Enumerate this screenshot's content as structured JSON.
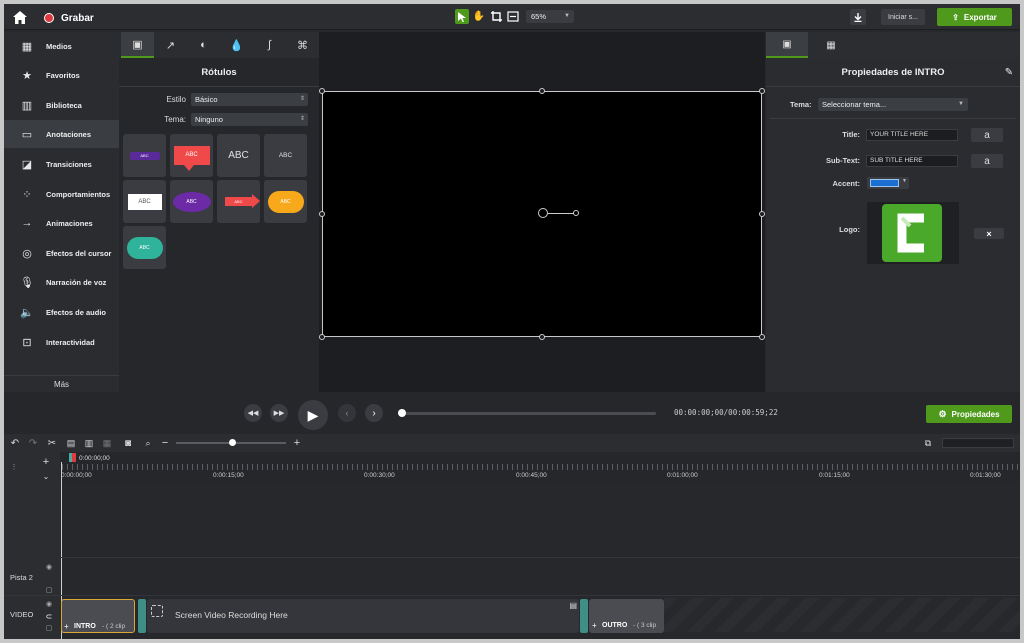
{
  "topbar": {
    "record_label": "Grabar",
    "zoom": "65%",
    "share_label": "Iniciar s...",
    "export_label": "Exportar"
  },
  "leftnav": {
    "items": [
      {
        "label": "Medios",
        "icon": "film-icon"
      },
      {
        "label": "Favoritos",
        "icon": "star-icon"
      },
      {
        "label": "Biblioteca",
        "icon": "library-icon"
      },
      {
        "label": "Anotaciones",
        "icon": "annotation-icon"
      },
      {
        "label": "Transiciones",
        "icon": "transition-icon"
      },
      {
        "label": "Comportamientos",
        "icon": "behavior-icon"
      },
      {
        "label": "Animaciones",
        "icon": "animation-icon"
      },
      {
        "label": "Efectos del cursor",
        "icon": "cursor-icon"
      },
      {
        "label": "Narración de voz",
        "icon": "microphone-icon"
      },
      {
        "label": "Efectos de audio",
        "icon": "speaker-icon"
      },
      {
        "label": "Interactividad",
        "icon": "interactivity-icon"
      }
    ],
    "more_label": "Más"
  },
  "library": {
    "title": "Rótulos",
    "style_label": "Estilo",
    "style_value": "Básico",
    "theme_label": "Tema:",
    "theme_value": "Ninguno",
    "tile_text": "ABC"
  },
  "properties": {
    "title": "Propiedades de INTRO",
    "theme_label": "Tema:",
    "theme_value": "Seleccionar tema...",
    "title_label": "Title:",
    "title_value": "YOUR TITLE HERE",
    "subtext_label": "Sub-Text:",
    "subtext_value": "SUB TITLE HERE",
    "accent_label": "Accent:",
    "accent_color": "#1a6fd0",
    "logo_label": "Logo:",
    "font_button": "a"
  },
  "player": {
    "time": "00:00:00;00/00:00:59;22",
    "properties_label": "Propiedades"
  },
  "timeline": {
    "playhead": "0:00:00;00",
    "ticks": [
      "0:00:00;00",
      "0:00:15;00",
      "0:00:30;00",
      "0:00:45;00",
      "0:01:00;00",
      "0:01:15;00",
      "0:01:30;00"
    ],
    "tracks": [
      "Pista 2",
      "VIDEO"
    ],
    "intro_label": "INTRO",
    "intro_meta": "- ( 2 clip",
    "recording_label": "Screen Video Recording Here",
    "outro_label": "OUTRO",
    "outro_meta": "- ( 3 clip"
  },
  "colors": {
    "accent_green": "#4f9a1c",
    "record_red": "#e0393e",
    "clip_teal": "#3f8f86"
  }
}
